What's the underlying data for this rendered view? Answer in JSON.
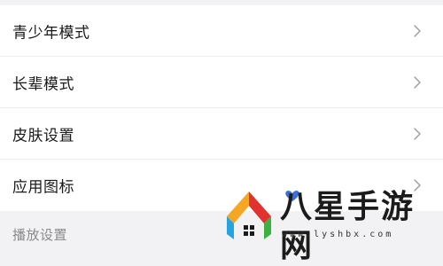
{
  "settings": {
    "items": [
      {
        "label": "青少年模式"
      },
      {
        "label": "长辈模式"
      },
      {
        "label": "皮肤设置"
      },
      {
        "label": "应用图标"
      }
    ],
    "section_title": "播放设置"
  },
  "watermark": {
    "name": "八星手游网",
    "url": "www.lyshbx.com"
  },
  "colors": {
    "background": "#f2f2f4",
    "row_background": "#ffffff",
    "text": "#1a1a1a",
    "section_text": "#8a8a8e",
    "chevron": "#9a9a9e"
  },
  "icons": {
    "row_arrow": "chevron-right-icon"
  }
}
